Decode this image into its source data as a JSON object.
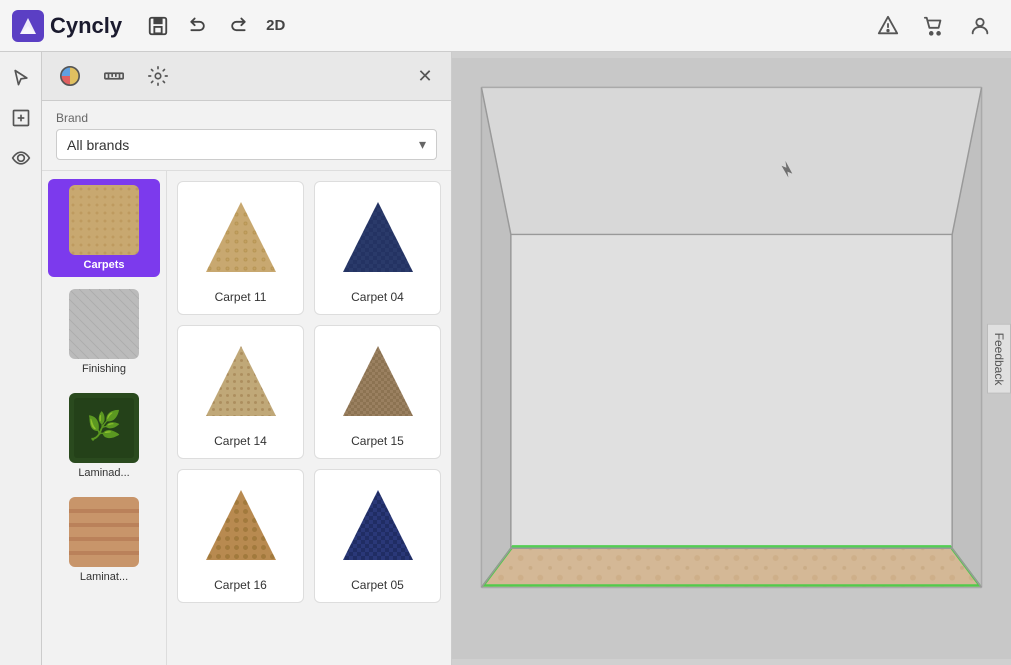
{
  "app": {
    "title": "Cyncly",
    "logo_text": "Cyncly",
    "view_mode": "2D"
  },
  "toolbar": {
    "save_label": "💾",
    "undo_label": "↩",
    "redo_label": "↪",
    "view_2d_label": "2D",
    "alert_icon": "⚠",
    "cart_icon": "🛒",
    "user_icon": "👤"
  },
  "panel": {
    "tabs": [
      {
        "id": "materials",
        "icon": "🎨"
      },
      {
        "id": "measure",
        "icon": "📏"
      },
      {
        "id": "settings",
        "icon": "⚙"
      }
    ],
    "close_label": "✕",
    "brand": {
      "label": "Brand",
      "value": "All brands",
      "arrow": "▾"
    }
  },
  "categories": [
    {
      "id": "carpets",
      "label": "Carpets",
      "active": true,
      "color1": "#c8a87a",
      "color2": "#b89060"
    },
    {
      "id": "finishing",
      "label": "Finishing",
      "active": false,
      "color1": "#aaaaaa",
      "color2": "#888888"
    },
    {
      "id": "laminad",
      "label": "Laminad...",
      "active": false,
      "color1": "#2a4a1e",
      "color2": "#1a3a0e"
    },
    {
      "id": "laminat",
      "label": "Laminat...",
      "active": false,
      "color1": "#c8956a",
      "color2": "#b07550"
    }
  ],
  "sidebar_icons": [
    {
      "id": "select",
      "icon": "↖",
      "label": "select-tool"
    },
    {
      "id": "add-room",
      "icon": "⊞",
      "label": "add-room"
    },
    {
      "id": "eye",
      "icon": "👁",
      "label": "view-tool"
    }
  ],
  "products": [
    {
      "id": "carpet11",
      "label": "Carpet 11",
      "color1": "#c8a870",
      "color2": "#b08848",
      "pattern": "loop"
    },
    {
      "id": "carpet04",
      "label": "Carpet 04",
      "color1": "#2a3a6a",
      "color2": "#1a2a5a",
      "pattern": "cut"
    },
    {
      "id": "carpet14",
      "label": "Carpet 14",
      "color1": "#c0a878",
      "color2": "#a88858",
      "pattern": "berber"
    },
    {
      "id": "carpet15",
      "label": "Carpet 15",
      "color1": "#9a8060",
      "color2": "#7a6040",
      "pattern": "texture"
    },
    {
      "id": "carpet16",
      "label": "Carpet 16",
      "color1": "#b88a50",
      "color2": "#987040",
      "pattern": "loop"
    },
    {
      "id": "carpet05",
      "label": "Carpet 05",
      "color1": "#2a3878",
      "color2": "#1a2858",
      "pattern": "cut"
    }
  ],
  "feedback": {
    "label": "Feedback"
  }
}
